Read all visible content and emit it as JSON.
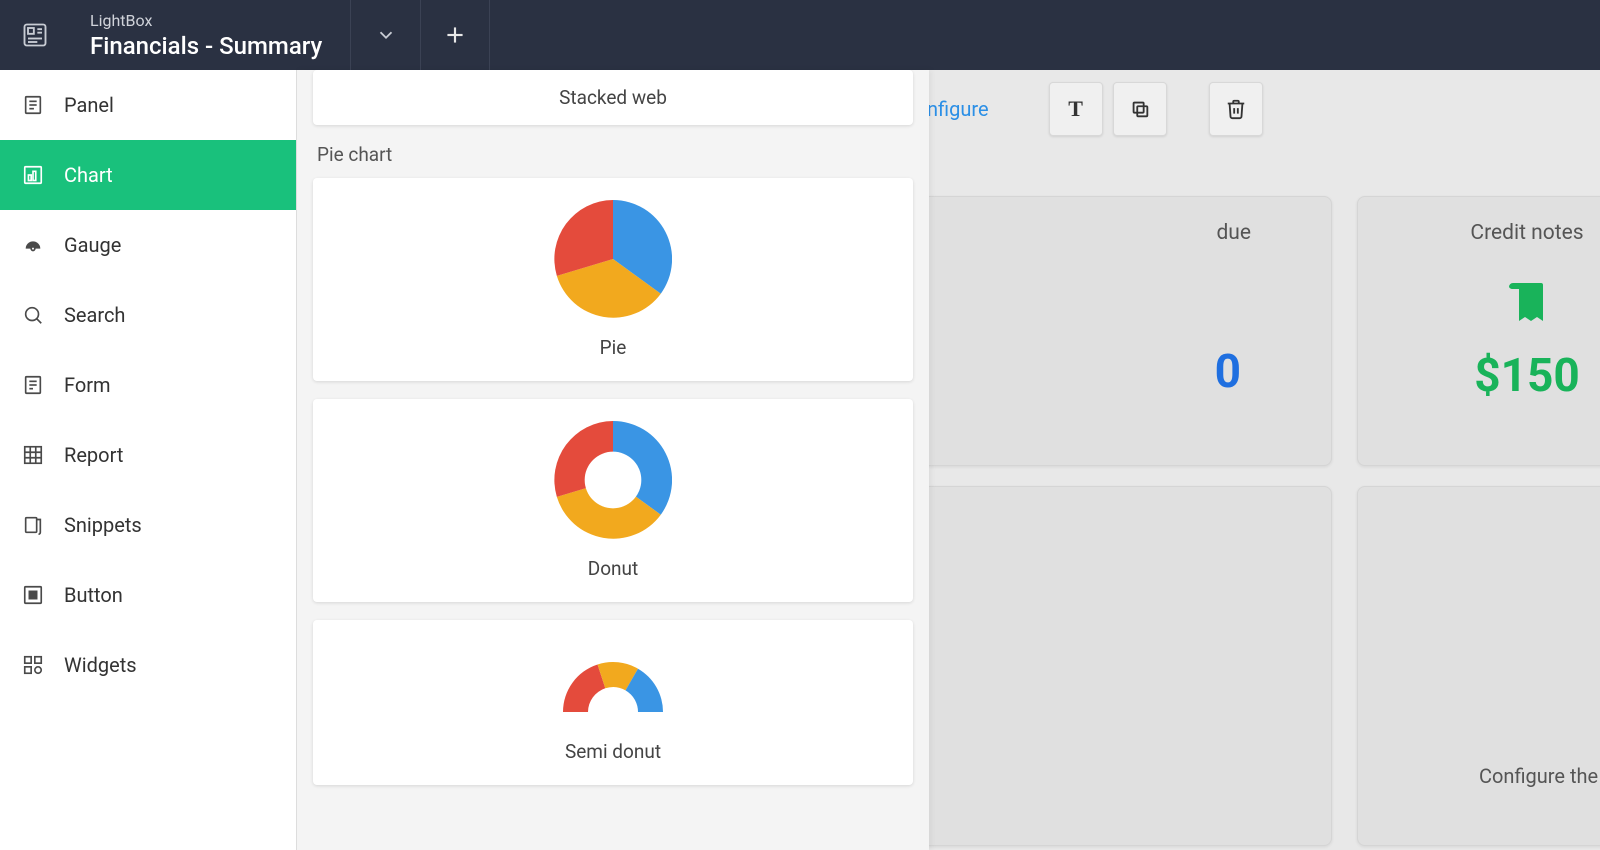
{
  "topbar": {
    "breadcrumb": "LightBox",
    "title": "Financials - Summary"
  },
  "sidebar": {
    "items": [
      {
        "label": "Panel"
      },
      {
        "label": "Chart"
      },
      {
        "label": "Gauge"
      },
      {
        "label": "Search"
      },
      {
        "label": "Form"
      },
      {
        "label": "Report"
      },
      {
        "label": "Snippets"
      },
      {
        "label": "Button"
      },
      {
        "label": "Widgets"
      }
    ]
  },
  "picker": {
    "stacked_web_label": "Stacked web",
    "section_pie_label": "Pie chart",
    "pie_label": "Pie",
    "donut_label": "Donut",
    "semi_donut_label": "Semi donut"
  },
  "canvas": {
    "configure_label": "nfigure",
    "card_due_title": "due",
    "card_due_value": "0",
    "card_credit_title": "Credit notes",
    "card_credit_value": "$150",
    "chart_hint": "Configure the chart type and data to b"
  }
}
